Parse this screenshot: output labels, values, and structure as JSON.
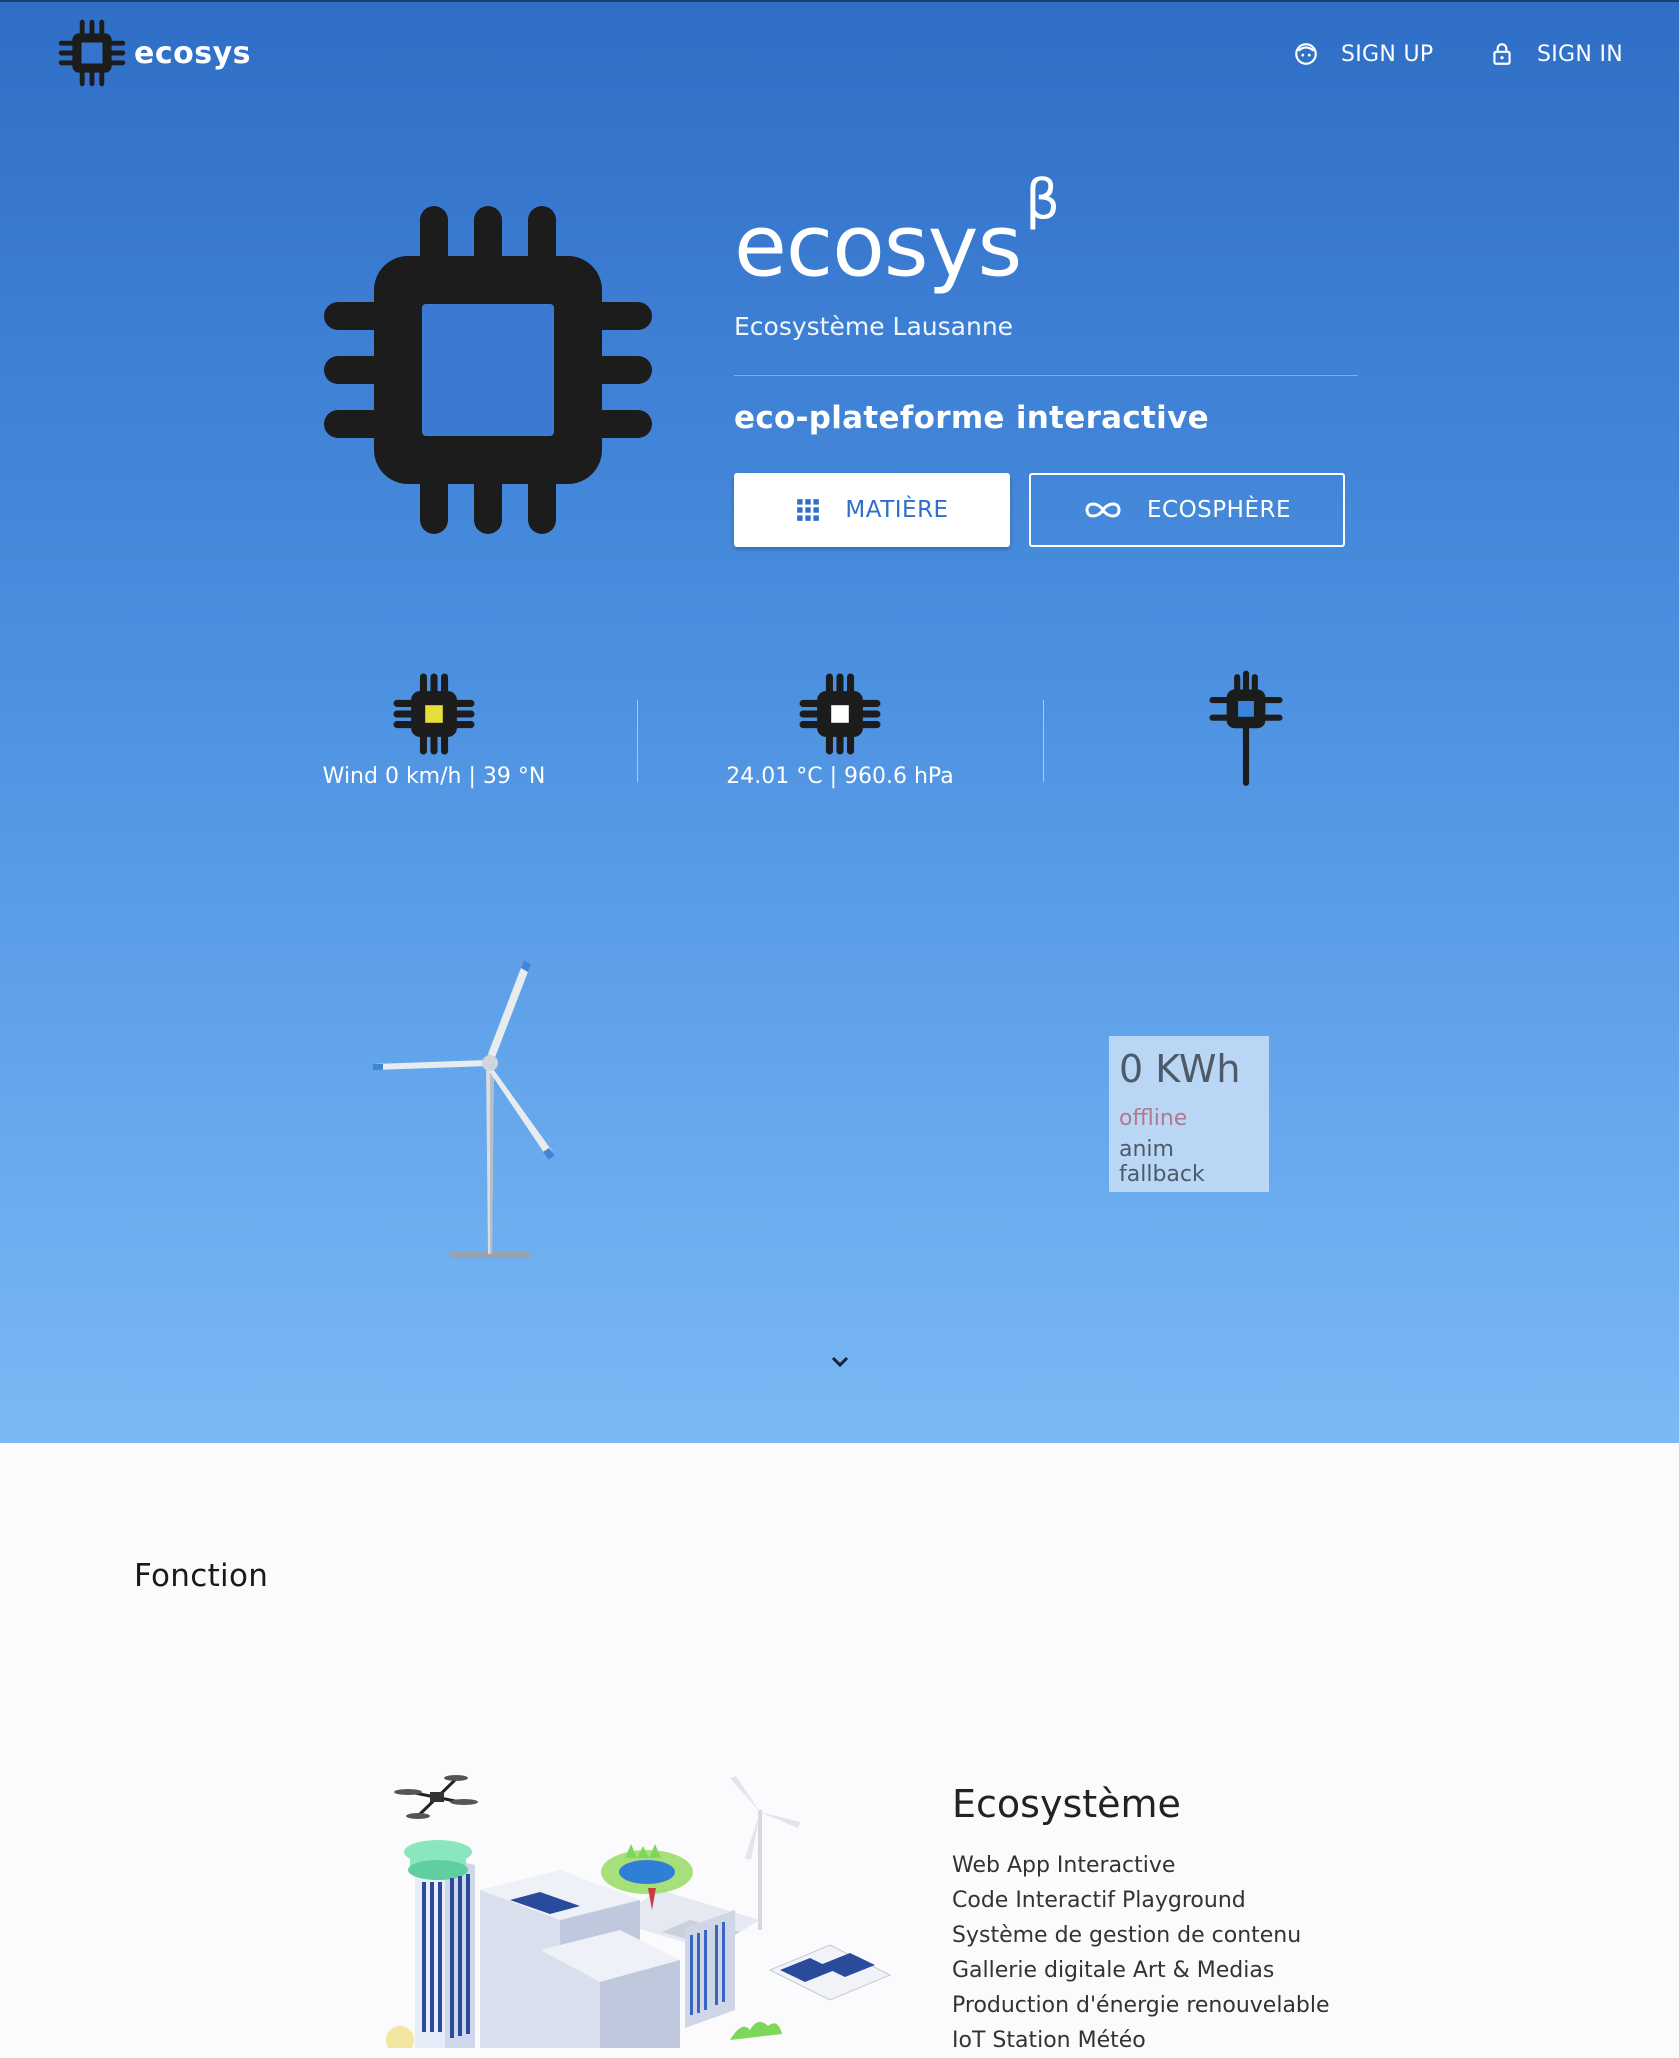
{
  "nav": {
    "brand": "ecosys",
    "signup_label": "SIGN UP",
    "signin_label": "SIGN IN",
    "signup_icon": "face-icon",
    "signin_icon": "lock-icon"
  },
  "hero": {
    "title": "ecosys",
    "title_sup": "β",
    "subtitle": "Ecosystème Lausanne",
    "tagline": "eco-plateforme interactive",
    "buttons": [
      {
        "label": "MATIÈRE",
        "icon": "grid-icon"
      },
      {
        "label": "ECOSPHÈRE",
        "icon": "infinity-icon"
      }
    ]
  },
  "stats": [
    {
      "text": "Wind 0 km/h | 39 °N",
      "icon": "chip-yellow-icon"
    },
    {
      "text": "24.01 °C | 960.6 hPa",
      "icon": "chip-white-icon"
    },
    {
      "text": "",
      "icon": "chip-antenna-icon"
    }
  ],
  "energy": {
    "value": "0 KWh",
    "status": "offline",
    "note": "anim fallback"
  },
  "fonction": {
    "title": "Fonction",
    "card": {
      "heading": "Ecosystème",
      "items": [
        "Web App Interactive",
        "Code Interactif Playground",
        "Système de gestion de contenu",
        "Gallerie digitale Art & Medias",
        "Production d'énergie renouvelable",
        "IoT Station Météo"
      ]
    }
  },
  "colors": {
    "hero_top": "#2f6ec6",
    "hero_bottom": "#7ab9f5",
    "button_text": "#2f6fc7",
    "offline": "#b07a8c"
  }
}
